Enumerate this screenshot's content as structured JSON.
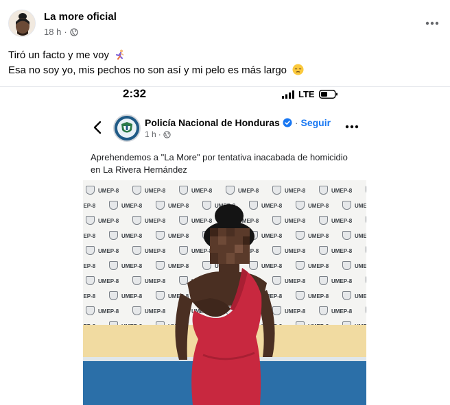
{
  "post": {
    "author": "La more oficial",
    "time": "18 h",
    "audience_icon": "globe-icon",
    "more_icon": "ellipsis-icon",
    "line1": "Tiró un facto y me voy",
    "line1_emoji": "running-person-emoji",
    "line2": "Esa no soy yo, mis pechos no son así  y mi pelo es más largo",
    "line2_emoji": "pensive-face-emoji"
  },
  "shared_screenshot": {
    "status_bar": {
      "time": "2:32",
      "network": "LTE",
      "signal_icon": "signal-bars-icon",
      "battery_icon": "battery-icon"
    },
    "page": {
      "name": "Policía Nacional de Honduras",
      "verified_icon": "verified-badge-icon",
      "separator": "·",
      "follow_label": "Seguir",
      "time": "1 h",
      "audience_icon": "globe-icon"
    },
    "caption": "Aprehendemos a \"La More\" por tentativa inacabada de homicidio en La Rivera Hernández",
    "photo": {
      "banner_text": "UMEP-8",
      "subject": "person-in-red-dress"
    }
  },
  "colors": {
    "link_blue": "#1877f2",
    "muted_text": "#65676b",
    "wall_blue": "#2b6fa8",
    "wall_yellow": "#f1dba1",
    "dress_red": "#c8283f"
  }
}
